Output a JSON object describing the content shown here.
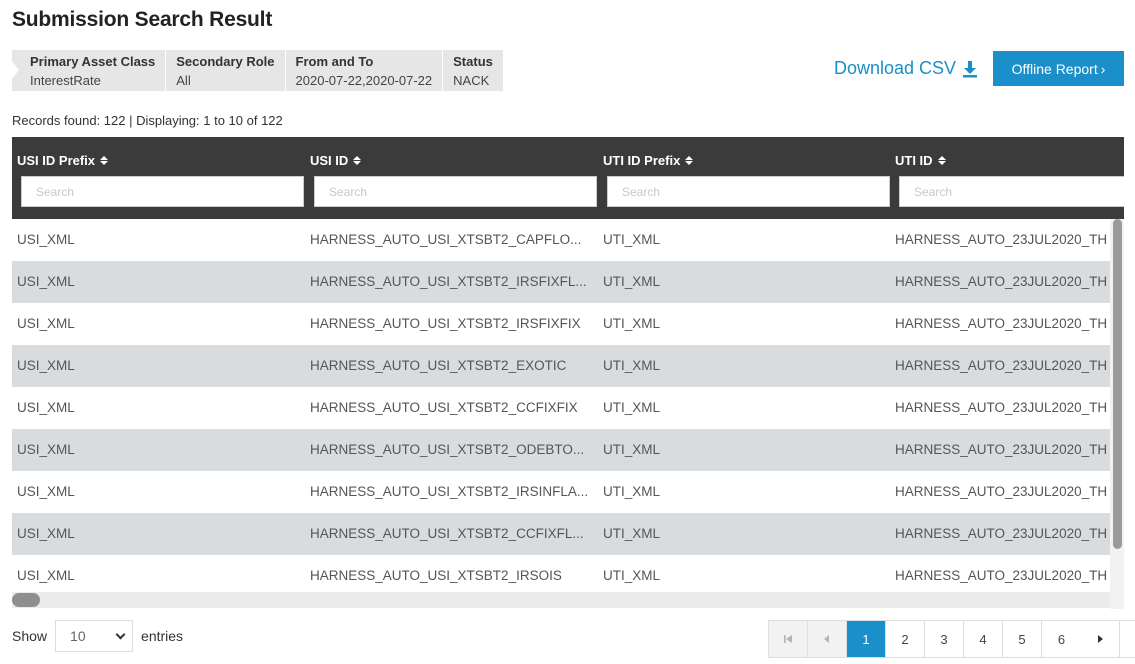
{
  "title": "Submission Search Result",
  "filters": [
    {
      "label": "Primary Asset Class",
      "value": "InterestRate"
    },
    {
      "label": "Secondary Role",
      "value": "All"
    },
    {
      "label": "From and To",
      "value": "2020-07-22,2020-07-22"
    },
    {
      "label": "Status",
      "value": "NACK"
    }
  ],
  "actions": {
    "download_csv_label": "Download CSV",
    "offline_report_label": "Offline Report",
    "offline_report_chevron": "›"
  },
  "records_info": "Records found: 122 | Displaying: 1 to 10 of 122",
  "table": {
    "columns": [
      {
        "label": "USI ID Prefix",
        "search_placeholder": "Search"
      },
      {
        "label": "USI ID",
        "search_placeholder": "Search"
      },
      {
        "label": "UTI ID Prefix",
        "search_placeholder": "Search"
      },
      {
        "label": "UTI ID",
        "search_placeholder": "Search"
      }
    ],
    "rows": [
      [
        "USI_XML",
        "HARNESS_AUTO_USI_XTSBT2_CAPFLO...",
        "UTI_XML",
        "HARNESS_AUTO_23JUL2020_TH"
      ],
      [
        "USI_XML",
        "HARNESS_AUTO_USI_XTSBT2_IRSFIXFL...",
        "UTI_XML",
        "HARNESS_AUTO_23JUL2020_TH"
      ],
      [
        "USI_XML",
        "HARNESS_AUTO_USI_XTSBT2_IRSFIXFIX",
        "UTI_XML",
        "HARNESS_AUTO_23JUL2020_TH"
      ],
      [
        "USI_XML",
        "HARNESS_AUTO_USI_XTSBT2_EXOTIC",
        "UTI_XML",
        "HARNESS_AUTO_23JUL2020_TH"
      ],
      [
        "USI_XML",
        "HARNESS_AUTO_USI_XTSBT2_CCFIXFIX",
        "UTI_XML",
        "HARNESS_AUTO_23JUL2020_TH"
      ],
      [
        "USI_XML",
        "HARNESS_AUTO_USI_XTSBT2_ODEBTO...",
        "UTI_XML",
        "HARNESS_AUTO_23JUL2020_TH"
      ],
      [
        "USI_XML",
        "HARNESS_AUTO_USI_XTSBT2_IRSINFLA...",
        "UTI_XML",
        "HARNESS_AUTO_23JUL2020_TH"
      ],
      [
        "USI_XML",
        "HARNESS_AUTO_USI_XTSBT2_CCFIXFL...",
        "UTI_XML",
        "HARNESS_AUTO_23JUL2020_TH"
      ],
      [
        "USI_XML",
        "HARNESS_AUTO_USI_XTSBT2_IRSOIS",
        "UTI_XML",
        "HARNESS_AUTO_23JUL2020_TH"
      ]
    ]
  },
  "footer": {
    "show_label": "Show",
    "entries_value": "10",
    "entries_label": "entries"
  },
  "pagination": {
    "pages": [
      "1",
      "2",
      "3",
      "4",
      "5",
      "6"
    ],
    "current": "1"
  },
  "colors": {
    "accent": "#1a8fc9",
    "header_bg": "#3b3b3b",
    "row_stripe": "#d9dcdf"
  }
}
